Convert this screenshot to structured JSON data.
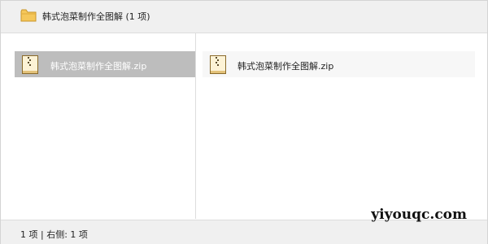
{
  "window": {
    "title": "韩式泡菜制作全图解 (1 项)",
    "icon": "folder-icon"
  },
  "left_pane": {
    "items": [
      {
        "label": "韩式泡菜制作全图解.zip",
        "icon": "zip-archive-icon",
        "selected": true
      }
    ]
  },
  "right_pane": {
    "items": [
      {
        "label": "韩式泡菜制作全图解.zip",
        "icon": "zip-archive-icon"
      }
    ]
  },
  "status": {
    "text": "1 项 | 右侧: 1 项"
  },
  "watermark": "yiyouqc.com",
  "colors": {
    "selection": "#bdbdbd",
    "folder": "#f5c75a",
    "bar_background": "#f0f0f0"
  }
}
